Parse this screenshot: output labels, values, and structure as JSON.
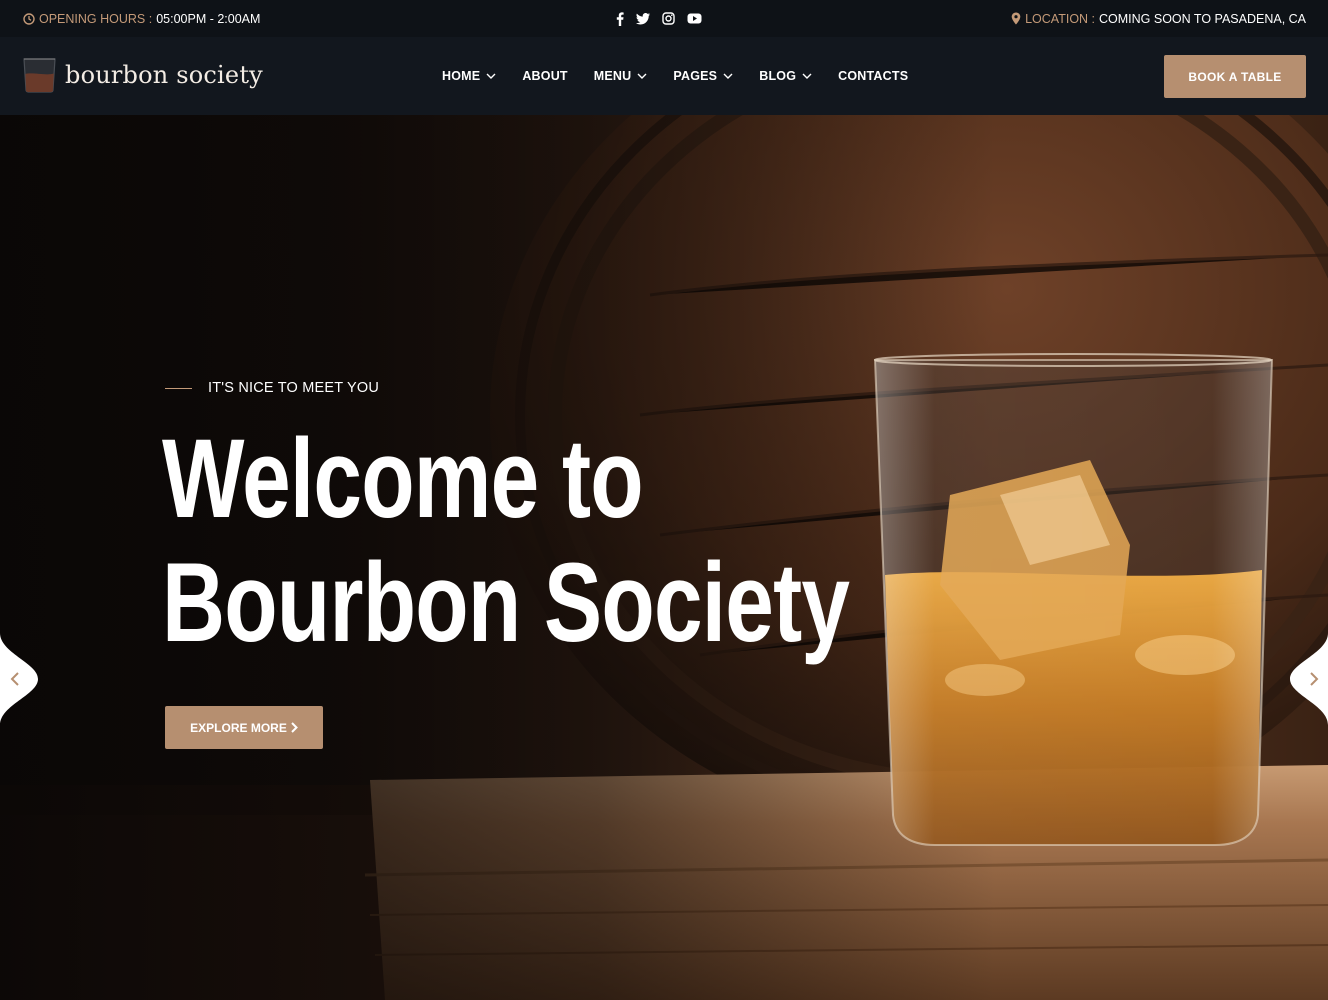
{
  "topbar": {
    "hours_label": "OPENING HOURS :",
    "hours_value": "05:00PM - 2:00AM",
    "location_label": "LOCATION :",
    "location_value": "COMING SOON TO PASADENA, CA",
    "social": [
      "facebook-icon",
      "twitter-icon",
      "instagram-icon",
      "youtube-icon"
    ]
  },
  "header": {
    "logo_text": "bourbon society",
    "nav": [
      {
        "label": "HOME",
        "dropdown": true
      },
      {
        "label": "ABOUT",
        "dropdown": false
      },
      {
        "label": "MENU",
        "dropdown": true
      },
      {
        "label": "PAGES",
        "dropdown": true
      },
      {
        "label": "BLOG",
        "dropdown": true
      },
      {
        "label": "CONTACTS",
        "dropdown": false
      }
    ],
    "cta_label": "BOOK A TABLE"
  },
  "hero": {
    "kicker": "IT'S NICE TO MEET YOU",
    "title_line1": "Welcome to",
    "title_line2": "Bourbon Society",
    "button_label": "EXPLORE MORE"
  },
  "colors": {
    "accent": "#c49a78",
    "button": "#b68f70",
    "topbar_bg": "#0e1217",
    "header_bg": "#12171e"
  }
}
